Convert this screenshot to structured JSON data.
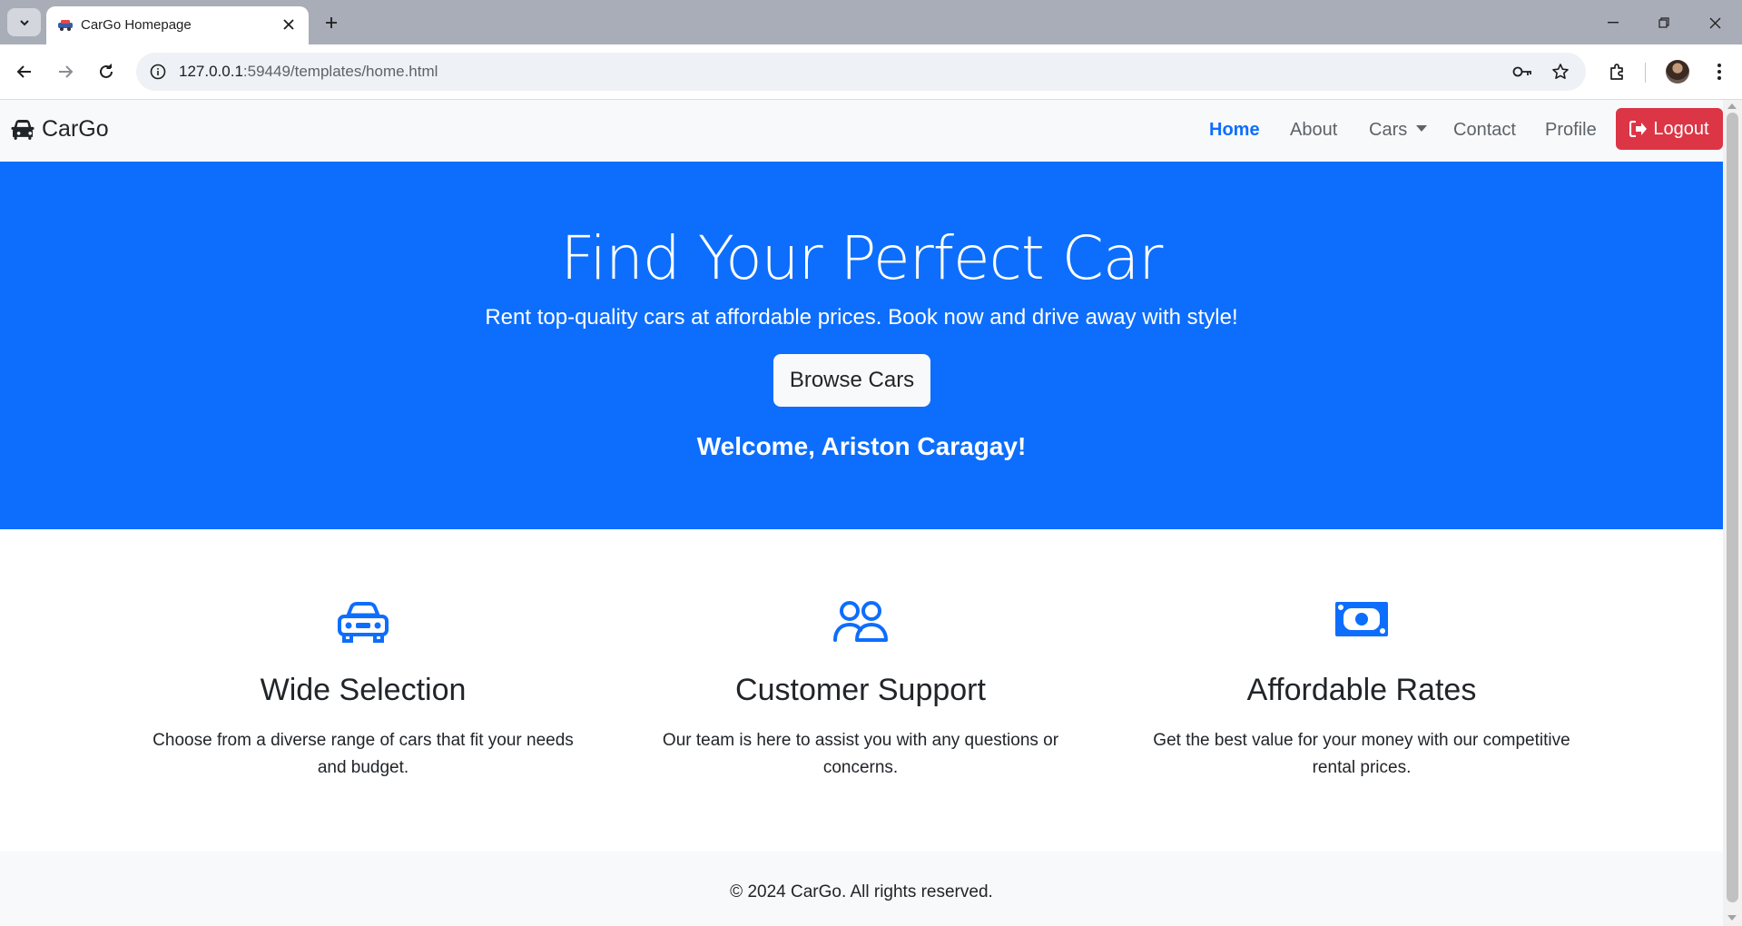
{
  "browser": {
    "tab_title": "CarGo Homepage",
    "url_host": "127.0.0.1",
    "url_path": ":59449/templates/home.html"
  },
  "navbar": {
    "brand": "CarGo",
    "links": {
      "home": "Home",
      "about": "About",
      "cars": "Cars",
      "contact": "Contact",
      "profile": "Profile"
    },
    "logout": "Logout"
  },
  "hero": {
    "title": "Find Your Perfect Car",
    "subtitle": "Rent top-quality cars at affordable prices. Book now and drive away with style!",
    "button": "Browse Cars",
    "welcome": "Welcome, Ariston Caragay!"
  },
  "features": [
    {
      "icon": "car-front-icon",
      "title": "Wide Selection",
      "text": "Choose from a diverse range of cars that fit your needs and budget."
    },
    {
      "icon": "people-icon",
      "title": "Customer Support",
      "text": "Our team is here to assist you with any questions or concerns."
    },
    {
      "icon": "cash-icon",
      "title": "Affordable Rates",
      "text": "Get the best value for your money with our competitive rental prices."
    }
  ],
  "footer": {
    "text": "© 2024 CarGo. All rights reserved."
  },
  "colors": {
    "primary": "#0d6efd",
    "danger": "#dc3545",
    "light": "#f8f9fa"
  }
}
